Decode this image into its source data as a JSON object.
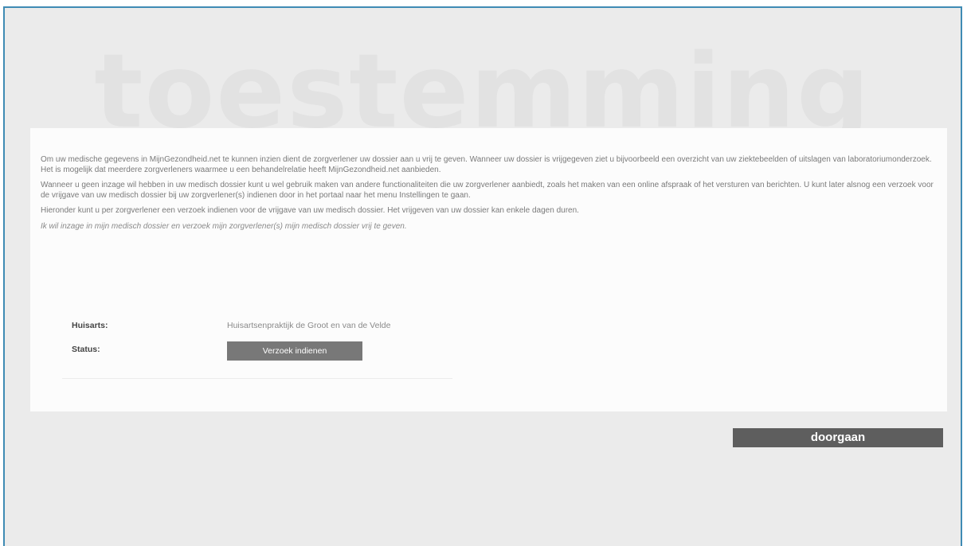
{
  "page": {
    "background_title": "toestemming",
    "colors": {
      "frame_border": "#3f8bb4",
      "background": "#ebebeb",
      "card": "#fcfcfc",
      "button": "#787878",
      "continue_button": "#5e5e5e"
    }
  },
  "intro": {
    "paragraphs": [
      "Om uw medische gegevens in MijnGezondheid.net te kunnen inzien dient de zorgverlener uw dossier aan u vrij te geven. Wanneer uw dossier is vrijgegeven ziet u bijvoorbeeld een overzicht van uw ziektebeelden of uitslagen van laboratoriumonderzoek. Het is mogelijk dat meerdere zorgverleners waarmee u een behandelrelatie heeft MijnGezondheid.net aanbieden.",
      "Wanneer u geen inzage wil hebben in uw medisch dossier kunt u wel gebruik maken van andere functionaliteiten die uw zorgverlener aanbiedt, zoals het maken van een online afspraak of het versturen van berichten. U kunt later alsnog een verzoek voor de vrijgave van uw medisch dossier bij uw zorgverlener(s) indienen door in het portaal naar het menu Instellingen te gaan.",
      "Hieronder kunt u per zorgverlener een verzoek indienen voor de vrijgave van uw medisch dossier. Het vrijgeven van uw dossier kan enkele dagen duren."
    ],
    "consent_statement": "Ik wil inzage in mijn medisch dossier en verzoek mijn zorgverlener(s) mijn medisch dossier vrij te geven."
  },
  "provider": {
    "huisarts_label": "Huisarts:",
    "huisarts_value": "Huisartsenpraktijk de Groot en van de Velde",
    "status_label": "Status:",
    "request_button_label": "Verzoek indienen"
  },
  "footer": {
    "continue_label": "doorgaan"
  }
}
